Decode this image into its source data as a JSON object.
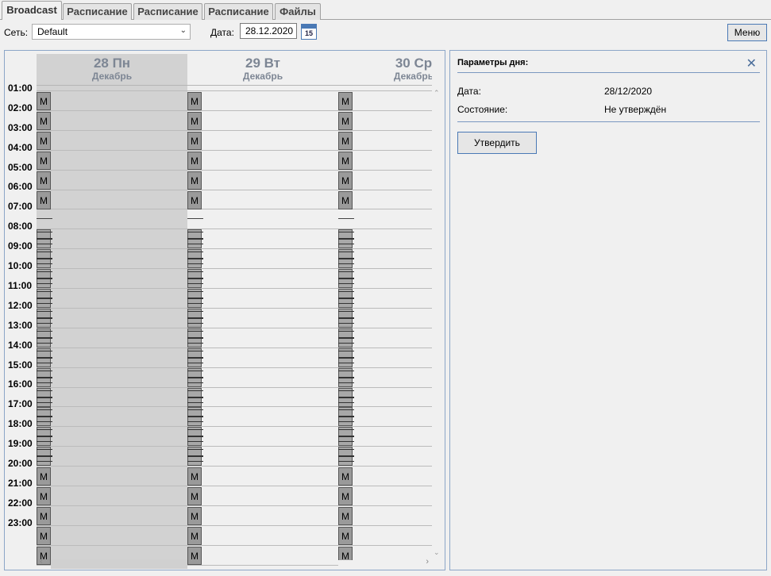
{
  "tabs": [
    {
      "label": "Broadcast",
      "active": true
    },
    {
      "label": "Расписание",
      "active": false
    },
    {
      "label": "Расписание",
      "active": false
    },
    {
      "label": "Расписание",
      "active": false
    },
    {
      "label": "Файлы",
      "active": false
    }
  ],
  "toolbar": {
    "network_label": "Сеть:",
    "network_value": "Default",
    "date_label": "Дата:",
    "date_value": "28.12.2020",
    "calendar_icon_day": "15",
    "menu_label": "Меню"
  },
  "calendar": {
    "days": [
      {
        "day": "28 Пн",
        "month": "Декабрь",
        "selected": true
      },
      {
        "day": "29 Вт",
        "month": "Декабрь",
        "selected": false
      },
      {
        "day": "30 Ср",
        "month": "Декабрь",
        "selected": false
      }
    ],
    "hours": [
      "01:00",
      "02:00",
      "03:00",
      "04:00",
      "05:00",
      "06:00",
      "07:00",
      "08:00",
      "09:00",
      "10:00",
      "11:00",
      "12:00",
      "13:00",
      "14:00",
      "15:00",
      "16:00",
      "17:00",
      "18:00",
      "19:00",
      "20:00",
      "21:00",
      "22:00",
      "23:00"
    ],
    "slot_label": "M"
  },
  "day_params": {
    "title": "Параметры дня:",
    "date_label": "Дата:",
    "date_value": "28/12/2020",
    "state_label": "Состояние:",
    "state_value": "Не утверждён",
    "approve_label": "Утвердить"
  },
  "colors": {
    "selected_day_bg": "#d2d2d2",
    "header_text": "#7d8694",
    "panel_border": "#8ca6c8"
  }
}
